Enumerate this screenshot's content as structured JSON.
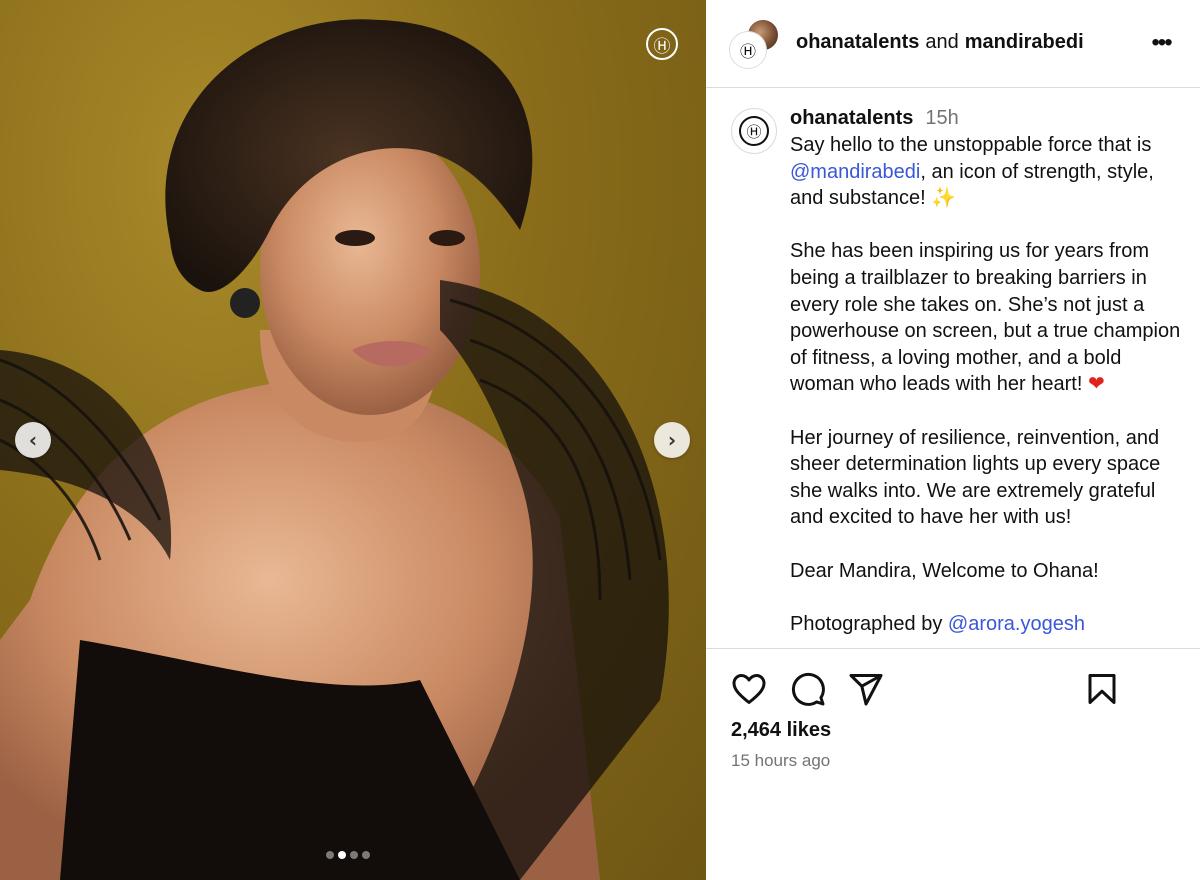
{
  "media": {
    "brand_mark": "Ⓗ",
    "prev_label": "‹",
    "next_label": "›",
    "carousel": {
      "count": 4,
      "active": 2
    }
  },
  "header": {
    "user1": "ohanatalents",
    "connector": "and",
    "user2": "mandirabedi",
    "more_label": "•••",
    "logo": "Ⓗ"
  },
  "caption": {
    "username": "ohanatalents",
    "time": "15h",
    "line1_pre": "Say hello to the unstoppable force that is ",
    "mention": "@mandirabedi",
    "line1_post": ", an icon of strength, style, and substance! ",
    "sparkle": "✨",
    "para2": "She has been inspiring us for years from being a trailblazer to breaking barriers in every role she takes on. She’s not just a powerhouse on screen, but a true champion of fitness, a loving mother, and a bold woman who leads with her heart! ",
    "heart": "❤",
    "para3": "Her journey of resilience, reinvention, and sheer determination lights up every space she walks into. We are extremely grateful and excited to have her with us!",
    "para4": "Dear Mandira, Welcome to Ohana!",
    "photo_credit_pre": "Photographed by ",
    "photo_credit_mention": "@arora.yogesh"
  },
  "stats": {
    "likes": "2,464 likes",
    "posted": "15 hours ago"
  },
  "icons": {
    "like": "heart-icon",
    "comment": "comment-icon",
    "share": "share-icon",
    "save": "bookmark-icon"
  }
}
